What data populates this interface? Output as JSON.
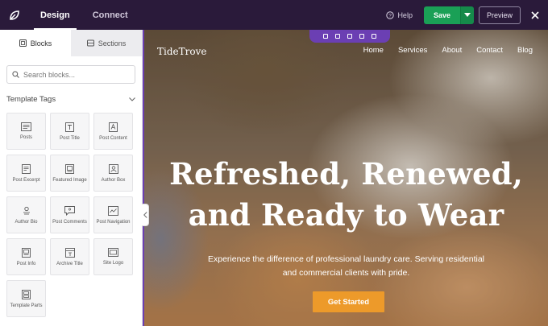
{
  "topbar": {
    "tabs": [
      "Design",
      "Connect"
    ],
    "help_label": "Help",
    "save_label": "Save",
    "preview_label": "Preview"
  },
  "panel": {
    "tabs": [
      "Blocks",
      "Sections"
    ],
    "search_placeholder": "Search blocks...",
    "section_title": "Template Tags",
    "blocks": [
      {
        "label": "Posts",
        "icon": "posts-icon"
      },
      {
        "label": "Post Title",
        "icon": "post-title-icon"
      },
      {
        "label": "Post Content",
        "icon": "post-content-icon"
      },
      {
        "label": "Post Excerpt",
        "icon": "post-excerpt-icon"
      },
      {
        "label": "Featured Image",
        "icon": "featured-image-icon"
      },
      {
        "label": "Author Box",
        "icon": "author-box-icon"
      },
      {
        "label": "Author Bio",
        "icon": "author-bio-icon"
      },
      {
        "label": "Post Comments",
        "icon": "post-comments-icon"
      },
      {
        "label": "Post Navigation",
        "icon": "post-navigation-icon"
      },
      {
        "label": "Post Info",
        "icon": "post-info-icon"
      },
      {
        "label": "Archive Title",
        "icon": "archive-title-icon"
      },
      {
        "label": "Site Logo",
        "icon": "site-logo-icon"
      },
      {
        "label": "Template Parts",
        "icon": "template-parts-icon"
      }
    ]
  },
  "site": {
    "logo": "TideTrove",
    "nav": [
      "Home",
      "Services",
      "About",
      "Contact",
      "Blog"
    ],
    "hero_title_line1": "Refreshed, Renewed,",
    "hero_title_line2": "and Ready to Wear",
    "hero_sub_line1": "Experience the difference of professional laundry care. Serving residential",
    "hero_sub_line2": "and commercial clients with pride.",
    "cta_label": "Get Started"
  },
  "colors": {
    "topbar": "#2a1a3a",
    "save": "#1aa056",
    "accent": "#6b3fb3",
    "cta": "#ed9a2a"
  }
}
